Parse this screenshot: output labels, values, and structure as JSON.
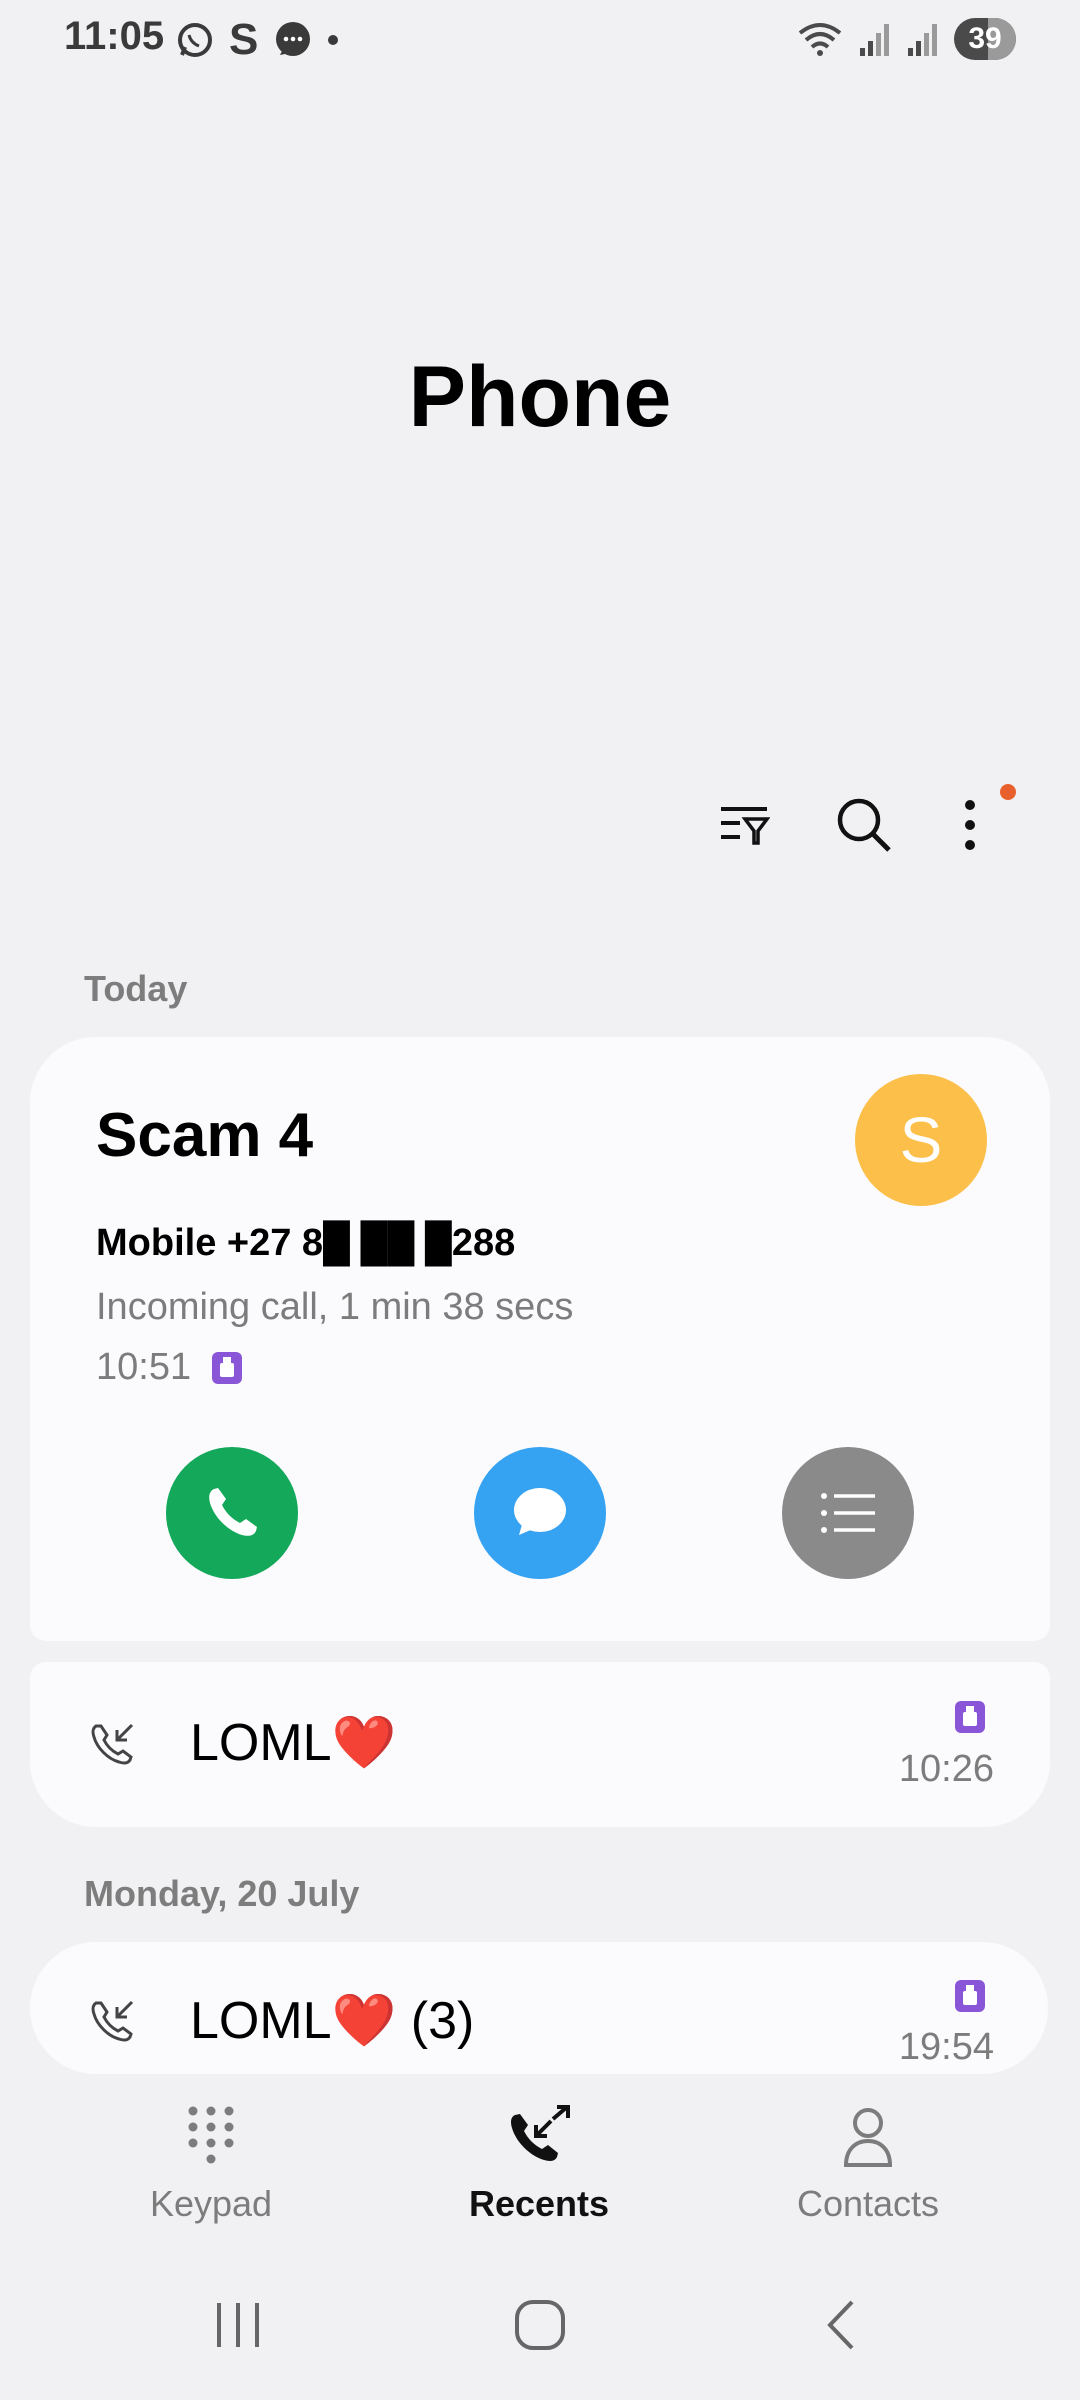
{
  "status_bar": {
    "time": "11:05",
    "left_icons": [
      "whatsapp-icon",
      "s-app-icon",
      "messages-icon",
      "dot-icon"
    ],
    "right_icons": [
      "wifi-icon",
      "signal-icon",
      "signal-icon"
    ],
    "battery": "39"
  },
  "header": {
    "title": "Phone"
  },
  "toolbar": {
    "icons": [
      "filter-icon",
      "search-icon",
      "more-options-icon"
    ],
    "notification_color": "#e8612c"
  },
  "sections": {
    "today": "Today",
    "monday": "Monday, 20 July"
  },
  "expanded_call": {
    "name": "Scam 4",
    "avatar_letter": "S",
    "avatar_color": "#fcbf4a",
    "number": "Mobile +27 8█ ██ █288",
    "detail": "Incoming call, 1 min 38 secs",
    "time": "10:51",
    "actions": [
      {
        "name": "call",
        "color": "#13a85a"
      },
      {
        "name": "message",
        "color": "#35a2f2"
      },
      {
        "name": "details",
        "color": "#8a8a8a"
      }
    ]
  },
  "calls": [
    {
      "name": "LOML❤️",
      "time": "10:26"
    },
    {
      "name": "LOML❤️ (3)",
      "time": "19:54"
    }
  ],
  "bottom_nav": {
    "keypad": "Keypad",
    "recents": "Recents",
    "contacts": "Contacts",
    "active": "Recents"
  },
  "sim_color": "#8a56d8"
}
